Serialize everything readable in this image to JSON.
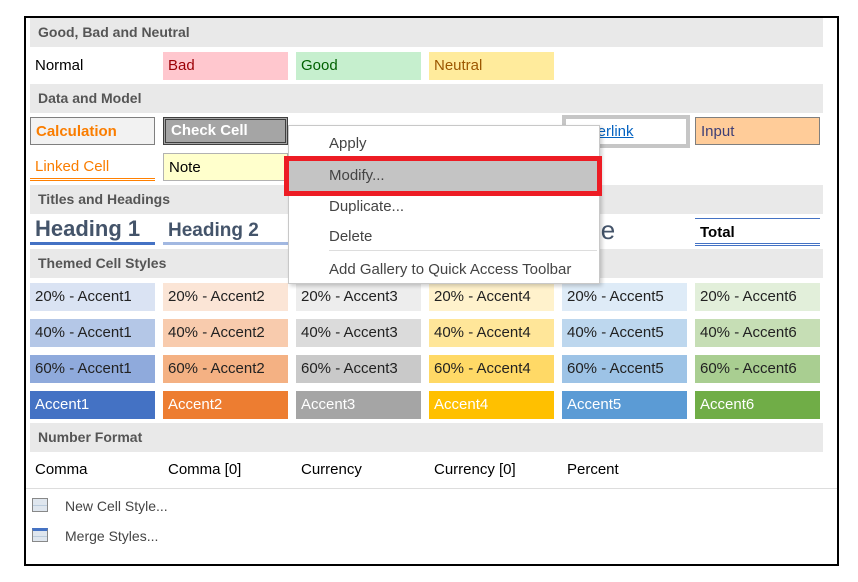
{
  "sections": {
    "good_bad": "Good, Bad and Neutral",
    "data_model": "Data and Model",
    "titles": "Titles and Headings",
    "themed": "Themed Cell Styles",
    "number": "Number Format"
  },
  "good_bad": [
    "Normal",
    "Bad",
    "Good",
    "Neutral"
  ],
  "data_model": {
    "row1": [
      "Calculation",
      "Check Cell",
      "Hyperlink",
      "Input"
    ],
    "row2": [
      "Linked Cell",
      "Note"
    ]
  },
  "titles": [
    "Heading 1",
    "Heading 2",
    "Title",
    "Total"
  ],
  "themed": {
    "r20": [
      "20% - Accent1",
      "20% - Accent2",
      "20% - Accent3",
      "20% - Accent4",
      "20% - Accent5",
      "20% - Accent6"
    ],
    "r40": [
      "40% - Accent1",
      "40% - Accent2",
      "40% - Accent3",
      "40% - Accent4",
      "40% - Accent5",
      "40% - Accent6"
    ],
    "r60": [
      "60% - Accent1",
      "60% - Accent2",
      "60% - Accent3",
      "60% - Accent4",
      "60% - Accent5",
      "60% - Accent6"
    ],
    "acc": [
      "Accent1",
      "Accent2",
      "Accent3",
      "Accent4",
      "Accent5",
      "Accent6"
    ]
  },
  "accent_colors": [
    "#4472c4",
    "#ed7d31",
    "#a5a5a5",
    "#ffc000",
    "#5b9bd5",
    "#70ad47"
  ],
  "number": [
    "Comma",
    "Comma [0]",
    "Currency",
    "Currency [0]",
    "Percent"
  ],
  "footer": {
    "new_style": "New Cell Style...",
    "merge": "Merge Styles..."
  },
  "context_menu": {
    "items": [
      "Apply",
      "Modify...",
      "Duplicate...",
      "Delete",
      "Add Gallery to Quick Access Toolbar"
    ],
    "highlighted": "Modify..."
  }
}
